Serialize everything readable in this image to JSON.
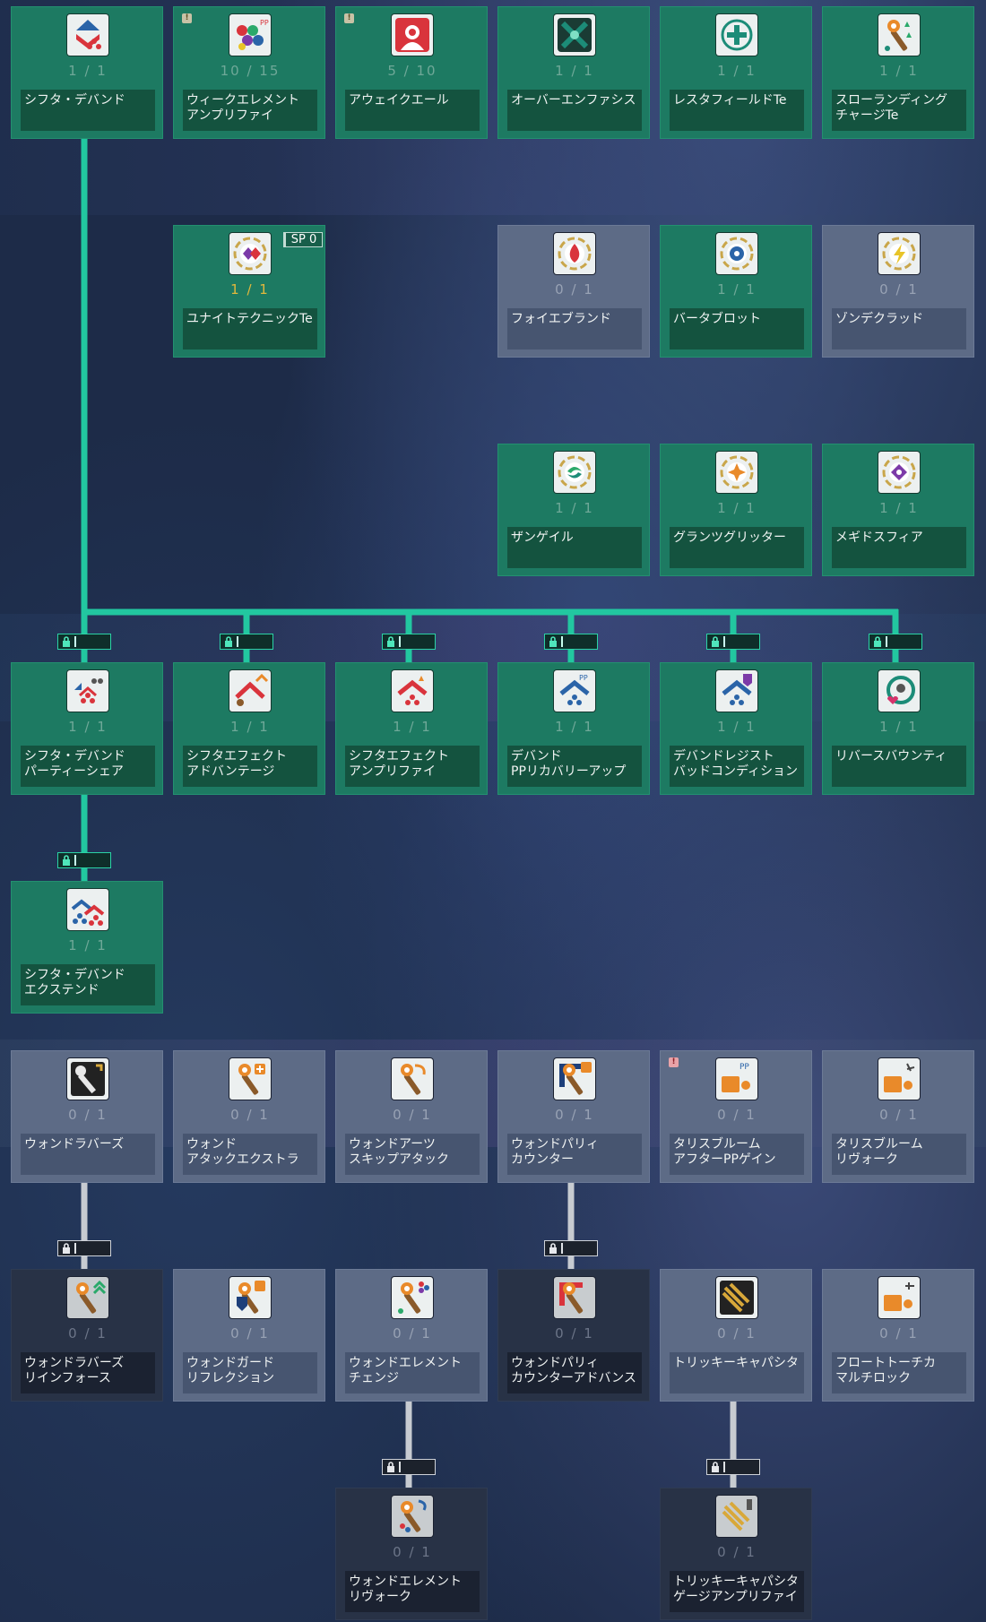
{
  "colors": {
    "tree_line_unlocked": "#22c7a0",
    "tree_line_locked": "#c7cbd1",
    "card_unlocked": "#1d7a62",
    "card_available": "#5d6b86",
    "card_locked": "#283246",
    "level_highlight": "#e2b83c"
  },
  "skills": [
    {
      "id": "shifta-deband",
      "name": "シフタ・デバンド",
      "level": "1 / 1",
      "icon": "diamond-triangles-icon",
      "state": "unlocked"
    },
    {
      "id": "weak-element-amplify",
      "name": "ウィークエレメント\nアンプリファイ",
      "level": "10 / 15",
      "icon": "elements-amplify-icon",
      "state": "unlocked",
      "badge": "!"
    },
    {
      "id": "awake-aile",
      "name": "アウェイクエール",
      "level": "5 / 10",
      "icon": "red-figure-pp-icon",
      "state": "unlocked",
      "badge": "!"
    },
    {
      "id": "over-emphasis",
      "name": "オーバーエンファシス",
      "level": "1 / 1",
      "icon": "cross-emblem-icon",
      "state": "unlocked"
    },
    {
      "id": "restafield-te",
      "name": "レスタフィールドTe",
      "level": "1 / 1",
      "icon": "green-cross-field-icon",
      "state": "unlocked"
    },
    {
      "id": "slow-landing-charge-te",
      "name": "スローランディング\nチャージTe",
      "level": "1 / 1",
      "icon": "wand-charge-icon",
      "state": "unlocked"
    },
    {
      "id": "unite-technique-te",
      "name": "ユナイトテクニックTe",
      "level": "1 / 1",
      "icon": "unite-gems-icon",
      "state": "unlocked",
      "sp": "SP 0",
      "gold": true
    },
    {
      "id": "foie-brand",
      "name": "フォイエブランド",
      "level": "0 / 1",
      "icon": "fire-brand-icon",
      "state": "available"
    },
    {
      "id": "barta-blot",
      "name": "バータブロット",
      "level": "1 / 1",
      "icon": "ice-blot-icon",
      "state": "unlocked"
    },
    {
      "id": "zonde-clad",
      "name": "ゾンデクラッド",
      "level": "0 / 1",
      "icon": "lightning-clad-icon",
      "state": "available"
    },
    {
      "id": "zan-gale",
      "name": "ザンゲイル",
      "level": "1 / 1",
      "icon": "wind-gale-icon",
      "state": "unlocked"
    },
    {
      "id": "grants-glitter",
      "name": "グランツグリッター",
      "level": "1 / 1",
      "icon": "light-glitter-icon",
      "state": "unlocked"
    },
    {
      "id": "megid-sphere",
      "name": "メギドスフィア",
      "level": "1 / 1",
      "icon": "dark-sphere-icon",
      "state": "unlocked"
    },
    {
      "id": "shifta-deband-party-share",
      "name": "シフタ・デバンド\nパーティーシェア",
      "level": "1 / 1",
      "icon": "party-share-icon",
      "state": "unlocked",
      "lock": true
    },
    {
      "id": "shifta-effect-advantage",
      "name": "シフタエフェクト\nアドバンテージ",
      "level": "1 / 1",
      "icon": "shifta-advantage-icon",
      "state": "unlocked",
      "lock": true
    },
    {
      "id": "shifta-effect-amplify",
      "name": "シフタエフェクト\nアンプリファイ",
      "level": "1 / 1",
      "icon": "shifta-amplify-icon",
      "state": "unlocked",
      "lock": true
    },
    {
      "id": "deband-pp-recovery-up",
      "name": "デバンド\nPPリカバリーアップ",
      "level": "1 / 1",
      "icon": "deband-pp-icon",
      "state": "unlocked",
      "lock": true
    },
    {
      "id": "deband-resist-bad-condition",
      "name": "デバンドレジスト\nバッドコンディション",
      "level": "1 / 1",
      "icon": "deband-resist-icon",
      "state": "unlocked",
      "lock": true
    },
    {
      "id": "reverse-bounty",
      "name": "リバースバウンティ",
      "level": "1 / 1",
      "icon": "reverse-heart-icon",
      "state": "unlocked",
      "lock": true
    },
    {
      "id": "shifta-deband-extend",
      "name": "シフタ・デバンド\nエクステンド",
      "level": "1 / 1",
      "icon": "deband-extend-icon",
      "state": "unlocked",
      "lock": true
    },
    {
      "id": "wand-lovers",
      "name": "ウォンドラバーズ",
      "level": "0 / 1",
      "icon": "wand-lovers-icon",
      "state": "available"
    },
    {
      "id": "wand-attack-extra",
      "name": "ウォンド\nアタックエクストラ",
      "level": "0 / 1",
      "icon": "wand-plus-icon",
      "state": "available"
    },
    {
      "id": "wand-arts-skip-attack",
      "name": "ウォンドアーツ\nスキップアタック",
      "level": "0 / 1",
      "icon": "wand-skip-icon",
      "state": "available"
    },
    {
      "id": "wand-parry-counter",
      "name": "ウォンドパリィ\nカウンター",
      "level": "0 / 1",
      "icon": "wand-parry-icon",
      "state": "available"
    },
    {
      "id": "talis-bloom-after-pp-gain",
      "name": "タリスブルーム\nアフターPPゲイン",
      "level": "0 / 1",
      "icon": "talis-pp-icon",
      "state": "available",
      "badge": "!",
      "badgeColor": "r"
    },
    {
      "id": "talis-bloom-revoke",
      "name": "タリスブルーム\nリヴォーク",
      "level": "0 / 1",
      "icon": "talis-revoke-icon",
      "state": "available"
    },
    {
      "id": "wand-lovers-reinforce",
      "name": "ウォンドラバーズ\nリインフォース",
      "level": "0 / 1",
      "icon": "wand-reinforce-icon",
      "state": "locked",
      "lock": true
    },
    {
      "id": "wand-guard-reflection",
      "name": "ウォンドガード\nリフレクション",
      "level": "0 / 1",
      "icon": "wand-guard-icon",
      "state": "available"
    },
    {
      "id": "wand-element-change",
      "name": "ウォンドエレメント\nチェンジ",
      "level": "0 / 1",
      "icon": "wand-element-icon",
      "state": "available"
    },
    {
      "id": "wand-parry-counter-advance",
      "name": "ウォンドパリィ\nカウンターアドバンス",
      "level": "0 / 1",
      "icon": "wand-parry-advance-icon",
      "state": "locked",
      "lock": true
    },
    {
      "id": "tricky-capacitor",
      "name": "トリッキーキャパシタ",
      "level": "0 / 1",
      "icon": "tricky-capacitor-icon",
      "state": "available"
    },
    {
      "id": "float-torch-multi-lock",
      "name": "フロートトーチカ\nマルチロック",
      "level": "0 / 1",
      "icon": "float-torch-icon",
      "state": "available"
    },
    {
      "id": "wand-element-revoke",
      "name": "ウォンドエレメント\nリヴォーク",
      "level": "0 / 1",
      "icon": "wand-element-revoke-icon",
      "state": "locked",
      "lock": true
    },
    {
      "id": "tricky-capacitor-gauge-amplify",
      "name": "トリッキーキャパシタ\nゲージアンプリファイ",
      "level": "0 / 1",
      "icon": "tricky-gauge-icon",
      "state": "locked",
      "lock": true
    }
  ]
}
